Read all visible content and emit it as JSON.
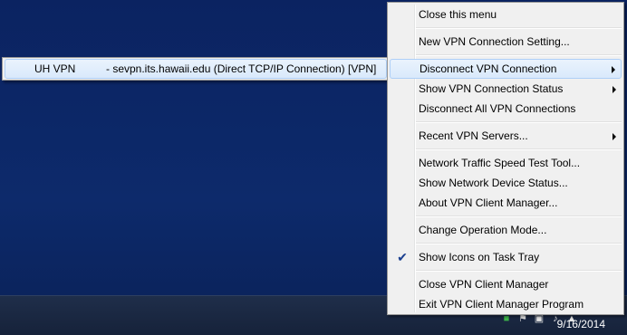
{
  "menu": {
    "items": [
      {
        "label": "Close this menu"
      },
      {
        "label": "New VPN Connection Setting..."
      },
      {
        "label": "Disconnect VPN Connection"
      },
      {
        "label": "Show VPN Connection Status"
      },
      {
        "label": "Disconnect All VPN Connections"
      },
      {
        "label": "Recent VPN Servers..."
      },
      {
        "label": "Network Traffic Speed Test Tool..."
      },
      {
        "label": "Show Network Device Status..."
      },
      {
        "label": "About VPN Client Manager..."
      },
      {
        "label": "Change Operation Mode..."
      },
      {
        "label": "Show Icons on Task Tray",
        "checked": true
      },
      {
        "label": "Close VPN Client Manager"
      },
      {
        "label": "Exit VPN Client Manager Program"
      }
    ]
  },
  "submenu": {
    "name": "UH VPN",
    "detail": "- sevpn.its.hawaii.edu (Direct TCP/IP Connection) [VPN]"
  },
  "taskbar": {
    "clock_date": "9/16/2014",
    "tray_icons": [
      "vpn-tray-icon",
      "flag-icon",
      "monitor-icon",
      "speaker-icon",
      "network-icon"
    ]
  },
  "colors": {
    "desktop": "#0c2461",
    "menu_bg": "#f0f0f0",
    "highlight": "#d9e9fb",
    "checkmark": "#1a3f8f"
  }
}
